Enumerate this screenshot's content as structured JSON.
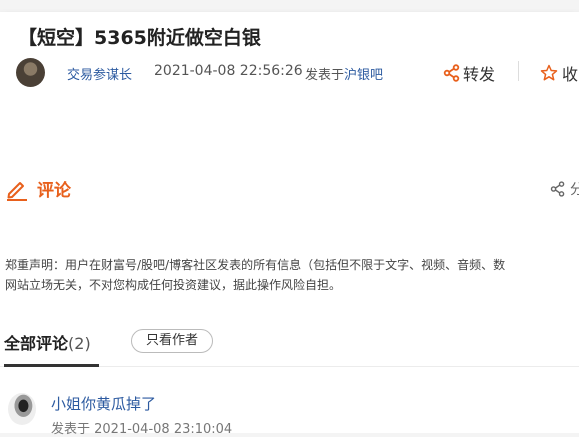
{
  "post": {
    "title": "【短空】5365附近做空白银",
    "author": "交易参谋长",
    "time": "2021-04-08 22:56:26",
    "posted_in_prefix": "发表于",
    "forum": "沪银吧",
    "share_label": "转发",
    "favorite_label": "收"
  },
  "comments_section": {
    "title": "评论",
    "share_label": "分",
    "disclaimer_line1": "郑重声明：用户在财富号/股吧/博客社区发表的所有信息（包括但不限于文字、视频、音频、数",
    "disclaimer_line2": "网站立场无关，不对您构成任何投资建议，据此操作风险自担。"
  },
  "tabs": {
    "all_label": "全部评论",
    "all_count": "(2)",
    "author_only_label": "只看作者"
  },
  "comments": [
    {
      "text": "小姐你黄瓜掉了",
      "meta": "发表于 2021-04-08 23:10:04"
    }
  ],
  "colors": {
    "accent": "#e8601c",
    "link": "#2c5aa0"
  },
  "icons": {
    "edit": "pencil-icon",
    "share": "share-icon",
    "favorite": "star-icon"
  }
}
